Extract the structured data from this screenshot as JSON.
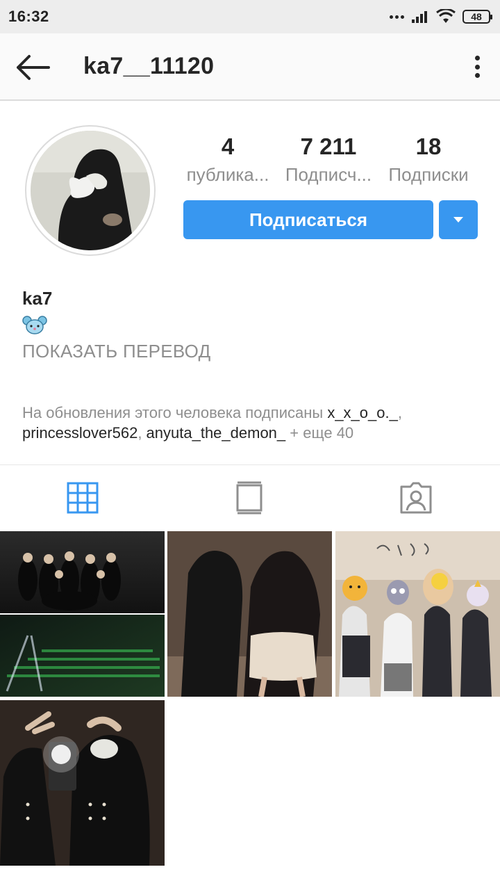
{
  "status_bar": {
    "time": "16:32",
    "battery": "48",
    "icons": [
      "dots-icon",
      "signal-icon",
      "wifi-icon",
      "battery-icon"
    ]
  },
  "app_bar": {
    "title": "ka7__11120",
    "back_icon": "arrow-left-icon",
    "more_icon": "more-vertical-icon"
  },
  "profile": {
    "stats": [
      {
        "value": "4",
        "label": "публика..."
      },
      {
        "value": "7 211",
        "label": "Подписч..."
      },
      {
        "value": "18",
        "label": "Подписки"
      }
    ],
    "follow_label": "Подписаться",
    "name": "ka7",
    "bio_emoji": "mouse-face-emoji",
    "translate_label": "ПОКАЗАТЬ ПЕРЕВОД",
    "followed_by": {
      "prefix": "На обновления этого человека подписаны ",
      "user1": "x_x_o_o._",
      "user2": "princesslover562",
      "user3": "anyuta_the_demon_",
      "more": "+ еще 40"
    }
  },
  "tabs": [
    {
      "name": "grid-icon",
      "active": true
    },
    {
      "name": "book-icon",
      "active": false
    },
    {
      "name": "tagged-person-icon",
      "active": false
    }
  ],
  "colors": {
    "accent": "#3897f0",
    "text": "#262626",
    "muted": "#8e8e8e"
  },
  "posts_count_shown": 4
}
